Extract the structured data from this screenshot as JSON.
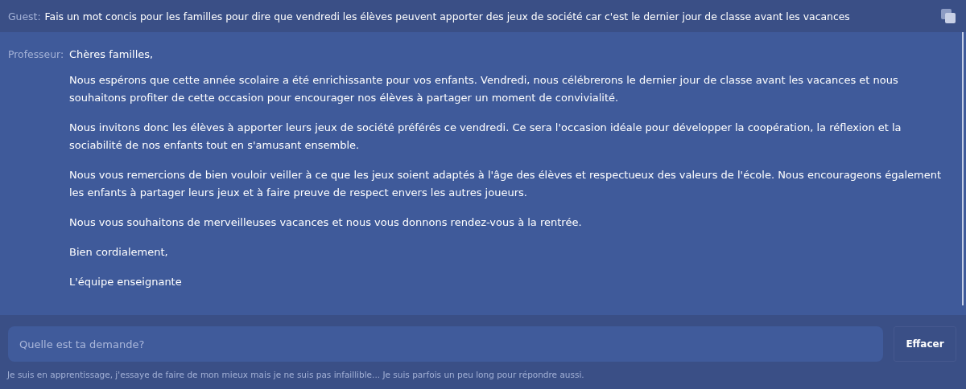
{
  "question": {
    "speaker": "Guest:",
    "text": "Fais un mot concis pour les familles pour dire que vendredi les élèves peuvent apporter des jeux de société car c'est le dernier jour de classe avant les vacances"
  },
  "answer": {
    "speaker": "Professeur:",
    "paragraphs": [
      "Chères familles,",
      "Nous espérons que cette année scolaire a été enrichissante pour vos enfants. Vendredi, nous célébrerons le dernier jour de classe avant les vacances et nous souhaitons profiter de cette occasion pour encourager nos élèves à partager un moment de convivialité.",
      "Nous invitons donc les élèves à apporter leurs jeux de société préférés ce vendredi. Ce sera l'occasion idéale pour développer la coopération, la réflexion et la sociabilité de nos enfants tout en s'amusant ensemble.",
      "Nous vous remercions de bien vouloir veiller à ce que les jeux soient adaptés à l'âge des élèves et respectueux des valeurs de l'école. Nous encourageons également les enfants à partager leurs jeux et à faire preuve de respect envers les autres joueurs.",
      "Nous vous souhaitons de merveilleuses vacances et nous vous donnons rendez-vous à la rentrée.",
      "Bien cordialement,",
      "L'équipe enseignante"
    ]
  },
  "input": {
    "placeholder": "Quelle est ta demande?"
  },
  "clear_button": "Effacer",
  "disclaimer": "Je suis en apprentissage, j'essaye de faire de mon mieux mais je ne suis pas infaillible... Je suis parfois un peu long pour répondre aussi."
}
